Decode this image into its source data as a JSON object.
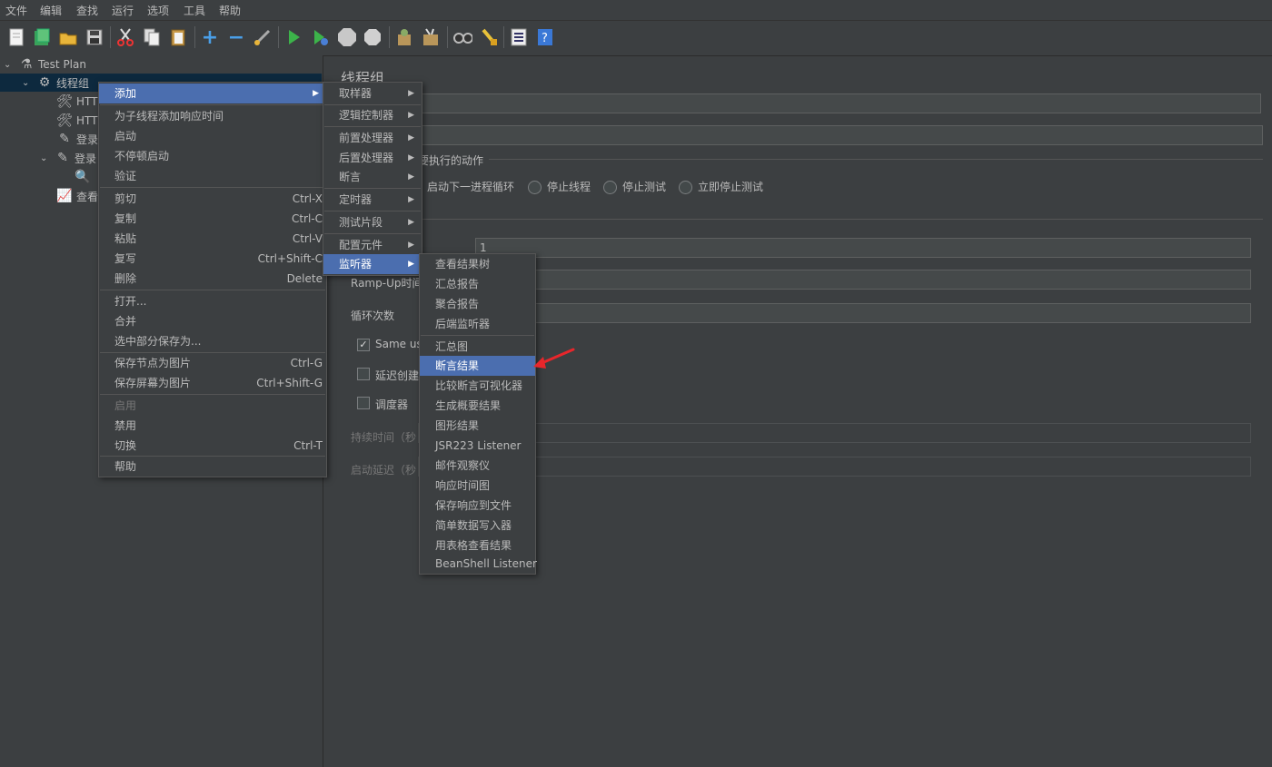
{
  "menubar": [
    "文件",
    "编辑",
    "查找",
    "运行",
    "选项",
    "工具",
    "帮助"
  ],
  "toolbar_icons": [
    "new-icon",
    "templates-icon",
    "open-icon",
    "save-icon",
    "cut-icon",
    "copy-icon",
    "paste-icon",
    "expand-icon",
    "collapse-icon",
    "toggle-icon",
    "start-icon",
    "start-no-pause-icon",
    "stop-icon",
    "shutdown-icon",
    "clear-icon",
    "clear-all-icon",
    "search-icon",
    "reset-search-icon",
    "function-helper-icon",
    "help-icon"
  ],
  "tree": {
    "test_plan": "Test Plan",
    "thread_group": "线程组",
    "http1": "HTT",
    "http2": "HTT",
    "login1": "登录",
    "login2": "登录",
    "view": "查看"
  },
  "panel": {
    "title": "线程组",
    "error_action_label": "要执行的动作",
    "radio_next_loop": "启动下一进程循环",
    "radio_stop_thread": "停止线程",
    "radio_stop_test": "停止测试",
    "radio_stop_now": "立即停止测试",
    "threads_value": "1",
    "rampup_label": "Ramp-Up时间",
    "loop_label": "循环次数",
    "same_user_label": "Same use",
    "delay_create_label": "延迟创建",
    "scheduler_label": "调度器",
    "duration_label": "持续时间（秒",
    "startup_delay_label": "启动延迟（秒"
  },
  "context_menu": {
    "add": "添加",
    "add_think_time": "为子线程添加响应时间",
    "start": "启动",
    "start_no_pause": "不停顿启动",
    "validate": "验证",
    "cut": "剪切",
    "cut_sc": "Ctrl-X",
    "copy": "复制",
    "copy_sc": "Ctrl-C",
    "paste": "粘贴",
    "paste_sc": "Ctrl-V",
    "duplicate": "复写",
    "duplicate_sc": "Ctrl+Shift-C",
    "delete": "删除",
    "delete_sc": "Delete",
    "open": "打开...",
    "merge": "合并",
    "save_selection": "选中部分保存为...",
    "save_node_image": "保存节点为图片",
    "save_node_image_sc": "Ctrl-G",
    "save_screen_image": "保存屏幕为图片",
    "save_screen_image_sc": "Ctrl+Shift-G",
    "enable": "启用",
    "disable": "禁用",
    "toggle": "切换",
    "toggle_sc": "Ctrl-T",
    "help": "帮助"
  },
  "add_menu": [
    "取样器",
    "逻辑控制器",
    "前置处理器",
    "后置处理器",
    "断言",
    "定时器",
    "测试片段",
    "配置元件",
    "监听器"
  ],
  "listener_menu": [
    "查看结果树",
    "汇总报告",
    "聚合报告",
    "后端监听器",
    "汇总图",
    "断言结果",
    "比较断言可视化器",
    "生成概要结果",
    "图形结果",
    "JSR223 Listener",
    "邮件观察仪",
    "响应时间图",
    "保存响应到文件",
    "简单数据写入器",
    "用表格查看结果",
    "BeanShell Listener"
  ],
  "colors": {
    "highlight": "#4b6eaf",
    "background": "#3c3f41",
    "arrow": "#e8262b"
  }
}
